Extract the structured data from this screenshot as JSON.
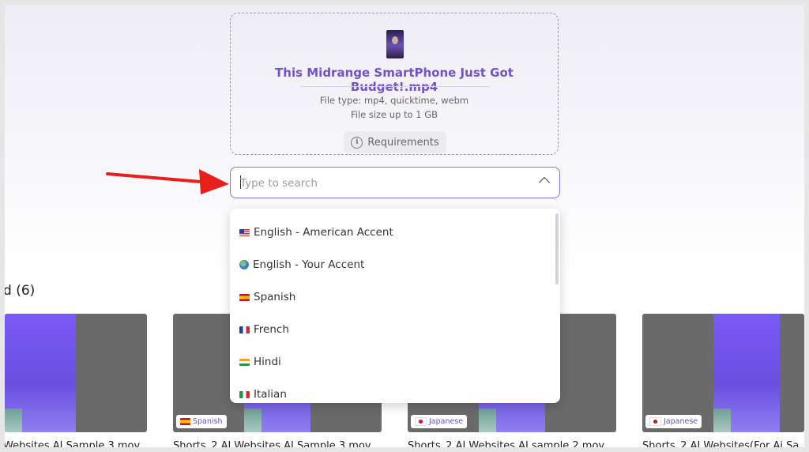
{
  "upload": {
    "file_name": "This Midrange SmartPhone Just Got Budget!.mp4",
    "file_type": "File type: mp4, quicktime, webm",
    "file_size": "File size up to 1 GB",
    "requirements_label": "Requirements"
  },
  "search": {
    "placeholder": "Type to search",
    "value": ""
  },
  "dropdown": {
    "options": [
      {
        "label": "English - American Accent",
        "icon": "us-flag-icon"
      },
      {
        "label": "English - Your Accent",
        "icon": "globe-icon"
      },
      {
        "label": "Spanish",
        "icon": "spain-flag-icon"
      },
      {
        "label": "French",
        "icon": "france-flag-icon"
      },
      {
        "label": "Hindi",
        "icon": "india-flag-icon"
      },
      {
        "label": "Italian",
        "icon": "italy-flag-icon"
      }
    ]
  },
  "library": {
    "title": "d (6)",
    "cards": [
      {
        "title": "Websites AI Sample 3.mov",
        "badge": ""
      },
      {
        "title": "Shorts_2 AI Websites AI Sample 3.mov",
        "badge": "Spanish"
      },
      {
        "title": "Shorts_2 AI Websites AI sample 2.mov",
        "badge": "Japanese"
      },
      {
        "title": "Shorts_2 AI Websites(For Ai Sa",
        "badge": "Japanese"
      }
    ]
  },
  "colors": {
    "accent": "#7252c8",
    "annotation_arrow": "#e8201c"
  }
}
